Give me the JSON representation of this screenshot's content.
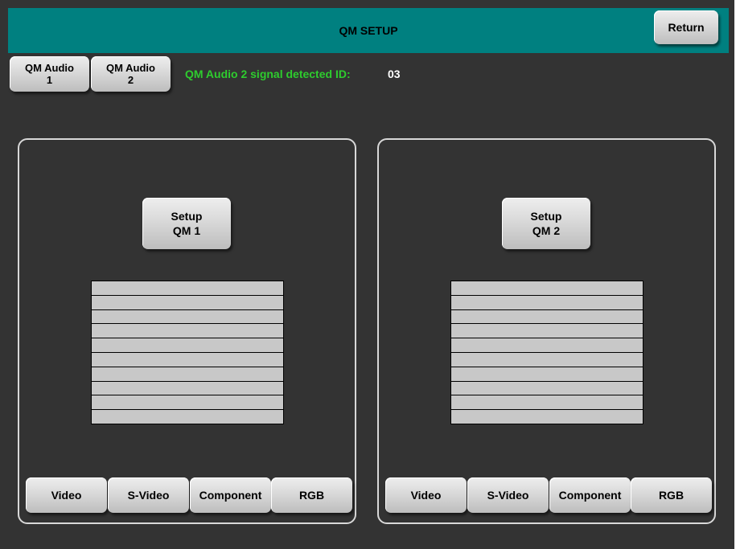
{
  "header": {
    "title": "QM SETUP",
    "return_label": "Return",
    "accent_color": "#008080"
  },
  "audio_tabs": [
    {
      "label": "QM Audio\n1"
    },
    {
      "label": "QM Audio\n2"
    }
  ],
  "signal": {
    "label": "QM Audio 2 signal detected ID:",
    "value": "03",
    "label_color": "#2ecc2e"
  },
  "panels": [
    {
      "setup_label": "Setup\nQM 1",
      "list_rows": 10,
      "inputs": [
        "Video",
        "S-Video",
        "Component",
        "RGB"
      ]
    },
    {
      "setup_label": "Setup\nQM 2",
      "list_rows": 10,
      "inputs": [
        "Video",
        "S-Video",
        "Component",
        "RGB"
      ]
    }
  ]
}
